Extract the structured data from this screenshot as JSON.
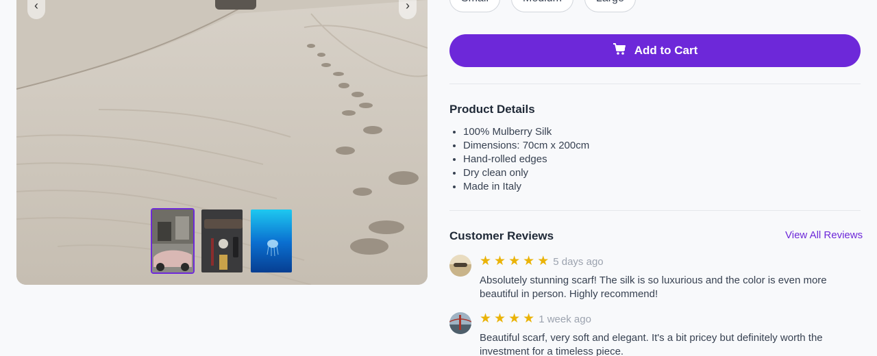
{
  "gallery": {
    "prev_icon": "chevron-left-icon",
    "next_icon": "chevron-right-icon",
    "thumbnails": [
      {
        "name": "thumb-old-car",
        "active": true
      },
      {
        "name": "thumb-accessories",
        "active": false
      },
      {
        "name": "thumb-jellyfish",
        "active": false
      }
    ]
  },
  "sizes": [
    "Small",
    "Medium",
    "Large"
  ],
  "cart": {
    "label": "Add to Cart",
    "icon": "cart-icon"
  },
  "details": {
    "title": "Product Details",
    "items": [
      "100% Mulberry Silk",
      "Dimensions: 70cm x 200cm",
      "Hand-rolled edges",
      "Dry clean only",
      "Made in Italy"
    ]
  },
  "reviews": {
    "title": "Customer Reviews",
    "view_all": "View All Reviews",
    "items": [
      {
        "stars": 5,
        "ago": "5 days ago",
        "text": "Absolutely stunning scarf! The silk is so luxurious and the color is even more beautiful in person. Highly recommend!"
      },
      {
        "stars": 4,
        "ago": "1 week ago",
        "text": "Beautiful scarf, very soft and elegant. It's a bit pricey but definitely worth the investment for a timeless piece."
      }
    ]
  },
  "colors": {
    "accent": "#6d28d9",
    "star": "#eab308"
  }
}
